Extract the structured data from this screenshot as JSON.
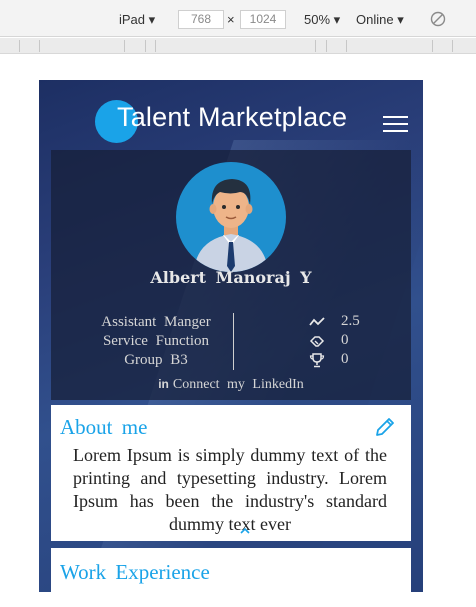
{
  "devtools": {
    "device": "iPad",
    "width": "768",
    "height": "1024",
    "times": "×",
    "zoom": "50%",
    "network": "Online"
  },
  "app": {
    "title": "Talent Marketplace",
    "accent_color": "#1aa3e8"
  },
  "profile": {
    "name": "Albert  Manoraj  Y",
    "role_lines": [
      "Assistant  Manger",
      "Service  Function",
      "Group  B3"
    ],
    "stats": [
      {
        "icon": "trend-icon",
        "value": "2.5"
      },
      {
        "icon": "handshake-icon",
        "value": "0"
      },
      {
        "icon": "trophy-icon",
        "value": "0"
      }
    ],
    "linkedin_label": "Connect  my  LinkedIn",
    "linkedin_prefix": "in"
  },
  "about": {
    "title": "About  me",
    "text": "Lorem Ipsum is simply dummy text of the printing and typesetting industry. Lorem Ipsum has been the industry's standard dummy text ever"
  },
  "work": {
    "title": "Work  Experience"
  }
}
